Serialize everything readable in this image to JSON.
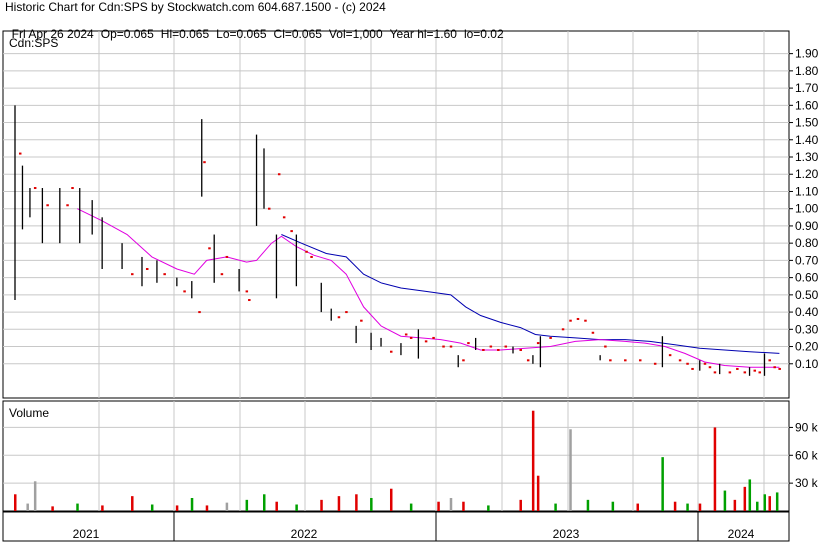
{
  "header": {
    "title": "Historic Chart for Cdn:SPS by Stockwatch.com 604.687.1500 - (c) 2024",
    "quote_parts": [
      "Fri Apr 26 2024",
      "Op=0.065",
      "Hi=0.065",
      "Lo=0.065",
      "Cl=0.065",
      "Vol=1,000",
      "Year hi=1.60",
      "lo=0.02"
    ]
  },
  "colors": {
    "price_bar": "#000000",
    "flat_day": "#e00000",
    "ma_short": "#e000e0",
    "ma_long": "#0000b0",
    "vol_up": "#00a000",
    "vol_down": "#e00000",
    "vol_flat": "#a0a0a0",
    "grid": "#c8c8c8"
  },
  "chart_data": [
    {
      "type": "ohlc",
      "label": "Cdn:SPS",
      "y_ticks": [
        "1.90",
        "1.80",
        "1.70",
        "1.60",
        "1.50",
        "1.40",
        "1.30",
        "1.20",
        "1.10",
        "1.00",
        "0.90",
        "0.80",
        "0.70",
        "0.60",
        "0.50",
        "0.40",
        "0.30",
        "0.20",
        "0.10"
      ],
      "ylim": [
        0.0,
        1.97
      ],
      "x_years": [
        "2021",
        "2022",
        "2023",
        "2024"
      ],
      "bars": [
        {
          "t": 2021.25,
          "h": 1.6,
          "l": 0.47
        },
        {
          "t": 2021.28,
          "h": 1.25,
          "l": 0.88
        },
        {
          "t": 2021.31,
          "h": 1.12,
          "l": 0.95
        },
        {
          "t": 2021.36,
          "h": 1.12,
          "l": 0.8
        },
        {
          "t": 2021.43,
          "h": 1.12,
          "l": 0.8
        },
        {
          "t": 2021.51,
          "h": 1.12,
          "l": 0.8
        },
        {
          "t": 2021.56,
          "h": 1.05,
          "l": 0.85
        },
        {
          "t": 2021.6,
          "h": 0.95,
          "l": 0.65
        },
        {
          "t": 2021.68,
          "h": 0.8,
          "l": 0.65
        },
        {
          "t": 2021.76,
          "h": 0.72,
          "l": 0.55
        },
        {
          "t": 2021.82,
          "h": 0.7,
          "l": 0.57
        },
        {
          "t": 2021.9,
          "h": 0.6,
          "l": 0.55
        },
        {
          "t": 2021.96,
          "h": 0.58,
          "l": 0.48
        },
        {
          "t": 2022.0,
          "h": 1.52,
          "l": 1.07
        },
        {
          "t": 2022.05,
          "h": 0.85,
          "l": 0.57
        },
        {
          "t": 2022.15,
          "h": 0.65,
          "l": 0.52
        },
        {
          "t": 2022.22,
          "h": 1.43,
          "l": 0.9
        },
        {
          "t": 2022.25,
          "h": 1.35,
          "l": 1.0
        },
        {
          "t": 2022.3,
          "h": 0.85,
          "l": 0.48
        },
        {
          "t": 2022.38,
          "h": 0.85,
          "l": 0.55
        },
        {
          "t": 2022.48,
          "h": 0.57,
          "l": 0.4
        },
        {
          "t": 2022.52,
          "h": 0.42,
          "l": 0.35
        },
        {
          "t": 2022.62,
          "h": 0.32,
          "l": 0.22
        },
        {
          "t": 2022.68,
          "h": 0.28,
          "l": 0.18
        },
        {
          "t": 2022.72,
          "h": 0.25,
          "l": 0.2
        },
        {
          "t": 2022.8,
          "h": 0.22,
          "l": 0.15
        },
        {
          "t": 2022.87,
          "h": 0.3,
          "l": 0.13
        },
        {
          "t": 2023.03,
          "h": 0.15,
          "l": 0.08
        },
        {
          "t": 2023.1,
          "h": 0.25,
          "l": 0.18
        },
        {
          "t": 2023.25,
          "h": 0.2,
          "l": 0.16
        },
        {
          "t": 2023.33,
          "h": 0.15,
          "l": 0.1
        },
        {
          "t": 2023.36,
          "h": 0.26,
          "l": 0.08
        },
        {
          "t": 2023.6,
          "h": 0.15,
          "l": 0.12
        },
        {
          "t": 2023.85,
          "h": 0.26,
          "l": 0.08
        },
        {
          "t": 2024.0,
          "h": 0.12,
          "l": 0.06
        },
        {
          "t": 2024.08,
          "h": 0.1,
          "l": 0.04
        },
        {
          "t": 2024.2,
          "h": 0.08,
          "l": 0.03
        },
        {
          "t": 2024.26,
          "h": 0.16,
          "l": 0.03
        }
      ],
      "flat_days": [
        {
          "t": 2021.27,
          "v": 1.32
        },
        {
          "t": 2021.33,
          "v": 1.12
        },
        {
          "t": 2021.38,
          "v": 1.02
        },
        {
          "t": 2021.46,
          "v": 1.02
        },
        {
          "t": 2021.48,
          "v": 1.12
        },
        {
          "t": 2021.72,
          "v": 0.62
        },
        {
          "t": 2021.78,
          "v": 0.65
        },
        {
          "t": 2021.85,
          "v": 0.62
        },
        {
          "t": 2021.93,
          "v": 0.52
        },
        {
          "t": 2021.99,
          "v": 0.4
        },
        {
          "t": 2022.01,
          "v": 1.27
        },
        {
          "t": 2022.03,
          "v": 0.77
        },
        {
          "t": 2022.08,
          "v": 0.62
        },
        {
          "t": 2022.1,
          "v": 0.72
        },
        {
          "t": 2022.18,
          "v": 0.52
        },
        {
          "t": 2022.19,
          "v": 0.47
        },
        {
          "t": 2022.27,
          "v": 1.0
        },
        {
          "t": 2022.31,
          "v": 1.2
        },
        {
          "t": 2022.33,
          "v": 0.95
        },
        {
          "t": 2022.36,
          "v": 0.87
        },
        {
          "t": 2022.42,
          "v": 0.75
        },
        {
          "t": 2022.44,
          "v": 0.72
        },
        {
          "t": 2022.55,
          "v": 0.37
        },
        {
          "t": 2022.58,
          "v": 0.4
        },
        {
          "t": 2022.64,
          "v": 0.35
        },
        {
          "t": 2022.76,
          "v": 0.17
        },
        {
          "t": 2022.82,
          "v": 0.27
        },
        {
          "t": 2022.84,
          "v": 0.25
        },
        {
          "t": 2022.9,
          "v": 0.23
        },
        {
          "t": 2022.93,
          "v": 0.25
        },
        {
          "t": 2022.97,
          "v": 0.2
        },
        {
          "t": 2023.0,
          "v": 0.2
        },
        {
          "t": 2023.05,
          "v": 0.12
        },
        {
          "t": 2023.07,
          "v": 0.22
        },
        {
          "t": 2023.13,
          "v": 0.18
        },
        {
          "t": 2023.16,
          "v": 0.2
        },
        {
          "t": 2023.19,
          "v": 0.18
        },
        {
          "t": 2023.22,
          "v": 0.2
        },
        {
          "t": 2023.28,
          "v": 0.18
        },
        {
          "t": 2023.31,
          "v": 0.12
        },
        {
          "t": 2023.35,
          "v": 0.22
        },
        {
          "t": 2023.4,
          "v": 0.25
        },
        {
          "t": 2023.45,
          "v": 0.3
        },
        {
          "t": 2023.48,
          "v": 0.35
        },
        {
          "t": 2023.51,
          "v": 0.36
        },
        {
          "t": 2023.54,
          "v": 0.35
        },
        {
          "t": 2023.57,
          "v": 0.28
        },
        {
          "t": 2023.62,
          "v": 0.2
        },
        {
          "t": 2023.64,
          "v": 0.12
        },
        {
          "t": 2023.7,
          "v": 0.12
        },
        {
          "t": 2023.76,
          "v": 0.12
        },
        {
          "t": 2023.82,
          "v": 0.1
        },
        {
          "t": 2023.88,
          "v": 0.15
        },
        {
          "t": 2023.92,
          "v": 0.12
        },
        {
          "t": 2023.95,
          "v": 0.1
        },
        {
          "t": 2023.97,
          "v": 0.07
        },
        {
          "t": 2024.02,
          "v": 0.1
        },
        {
          "t": 2024.04,
          "v": 0.08
        },
        {
          "t": 2024.06,
          "v": 0.05
        },
        {
          "t": 2024.12,
          "v": 0.05
        },
        {
          "t": 2024.15,
          "v": 0.07
        },
        {
          "t": 2024.18,
          "v": 0.05
        },
        {
          "t": 2024.22,
          "v": 0.06
        },
        {
          "t": 2024.24,
          "v": 0.05
        },
        {
          "t": 2024.28,
          "v": 0.12
        },
        {
          "t": 2024.3,
          "v": 0.08
        },
        {
          "t": 2024.32,
          "v": 0.07
        }
      ],
      "ma_short": [
        {
          "t": 2021.5,
          "v": 1.0
        },
        {
          "t": 2021.6,
          "v": 0.93
        },
        {
          "t": 2021.7,
          "v": 0.85
        },
        {
          "t": 2021.8,
          "v": 0.72
        },
        {
          "t": 2021.9,
          "v": 0.65
        },
        {
          "t": 2021.97,
          "v": 0.62
        },
        {
          "t": 2022.02,
          "v": 0.7
        },
        {
          "t": 2022.1,
          "v": 0.72
        },
        {
          "t": 2022.18,
          "v": 0.69
        },
        {
          "t": 2022.22,
          "v": 0.7
        },
        {
          "t": 2022.28,
          "v": 0.8
        },
        {
          "t": 2022.32,
          "v": 0.84
        },
        {
          "t": 2022.38,
          "v": 0.78
        },
        {
          "t": 2022.45,
          "v": 0.73
        },
        {
          "t": 2022.52,
          "v": 0.7
        },
        {
          "t": 2022.58,
          "v": 0.62
        },
        {
          "t": 2022.65,
          "v": 0.43
        },
        {
          "t": 2022.72,
          "v": 0.32
        },
        {
          "t": 2022.8,
          "v": 0.26
        },
        {
          "t": 2022.88,
          "v": 0.25
        },
        {
          "t": 2022.96,
          "v": 0.24
        },
        {
          "t": 2023.04,
          "v": 0.22
        },
        {
          "t": 2023.12,
          "v": 0.18
        },
        {
          "t": 2023.2,
          "v": 0.18
        },
        {
          "t": 2023.3,
          "v": 0.19
        },
        {
          "t": 2023.4,
          "v": 0.2
        },
        {
          "t": 2023.5,
          "v": 0.23
        },
        {
          "t": 2023.6,
          "v": 0.24
        },
        {
          "t": 2023.7,
          "v": 0.23
        },
        {
          "t": 2023.78,
          "v": 0.22
        },
        {
          "t": 2023.86,
          "v": 0.2
        },
        {
          "t": 2023.94,
          "v": 0.16
        },
        {
          "t": 2024.02,
          "v": 0.11
        },
        {
          "t": 2024.1,
          "v": 0.09
        },
        {
          "t": 2024.2,
          "v": 0.08
        },
        {
          "t": 2024.32,
          "v": 0.08
        }
      ],
      "ma_long": [
        {
          "t": 2022.32,
          "v": 0.85
        },
        {
          "t": 2022.4,
          "v": 0.8
        },
        {
          "t": 2022.5,
          "v": 0.74
        },
        {
          "t": 2022.58,
          "v": 0.72
        },
        {
          "t": 2022.65,
          "v": 0.62
        },
        {
          "t": 2022.72,
          "v": 0.57
        },
        {
          "t": 2022.8,
          "v": 0.54
        },
        {
          "t": 2022.9,
          "v": 0.52
        },
        {
          "t": 2023.0,
          "v": 0.5
        },
        {
          "t": 2023.06,
          "v": 0.43
        },
        {
          "t": 2023.12,
          "v": 0.38
        },
        {
          "t": 2023.2,
          "v": 0.34
        },
        {
          "t": 2023.28,
          "v": 0.31
        },
        {
          "t": 2023.34,
          "v": 0.27
        },
        {
          "t": 2023.4,
          "v": 0.26
        },
        {
          "t": 2023.5,
          "v": 0.25
        },
        {
          "t": 2023.6,
          "v": 0.24
        },
        {
          "t": 2023.7,
          "v": 0.24
        },
        {
          "t": 2023.8,
          "v": 0.23
        },
        {
          "t": 2023.9,
          "v": 0.21
        },
        {
          "t": 2024.0,
          "v": 0.19
        },
        {
          "t": 2024.1,
          "v": 0.18
        },
        {
          "t": 2024.2,
          "v": 0.17
        },
        {
          "t": 2024.32,
          "v": 0.16
        }
      ]
    },
    {
      "type": "bar",
      "label": "Volume",
      "y_ticks": [
        "90 k",
        "60 k",
        "30 k"
      ],
      "ylim": [
        0,
        112
      ],
      "volumes": [
        {
          "t": 2021.25,
          "v": 18,
          "c": "down"
        },
        {
          "t": 2021.3,
          "v": 8,
          "c": "flat"
        },
        {
          "t": 2021.33,
          "v": 32,
          "c": "flat"
        },
        {
          "t": 2021.4,
          "v": 5,
          "c": "down"
        },
        {
          "t": 2021.5,
          "v": 8,
          "c": "up"
        },
        {
          "t": 2021.6,
          "v": 6,
          "c": "down"
        },
        {
          "t": 2021.72,
          "v": 16,
          "c": "down"
        },
        {
          "t": 2021.8,
          "v": 7,
          "c": "up"
        },
        {
          "t": 2021.9,
          "v": 6,
          "c": "down"
        },
        {
          "t": 2021.96,
          "v": 14,
          "c": "up"
        },
        {
          "t": 2022.02,
          "v": 6,
          "c": "down"
        },
        {
          "t": 2022.1,
          "v": 9,
          "c": "flat"
        },
        {
          "t": 2022.18,
          "v": 12,
          "c": "up"
        },
        {
          "t": 2022.25,
          "v": 18,
          "c": "up"
        },
        {
          "t": 2022.3,
          "v": 10,
          "c": "down"
        },
        {
          "t": 2022.38,
          "v": 7,
          "c": "up"
        },
        {
          "t": 2022.48,
          "v": 12,
          "c": "down"
        },
        {
          "t": 2022.55,
          "v": 16,
          "c": "down"
        },
        {
          "t": 2022.62,
          "v": 18,
          "c": "down"
        },
        {
          "t": 2022.68,
          "v": 14,
          "c": "up"
        },
        {
          "t": 2022.76,
          "v": 24,
          "c": "down"
        },
        {
          "t": 2022.84,
          "v": 8,
          "c": "up"
        },
        {
          "t": 2022.95,
          "v": 10,
          "c": "down"
        },
        {
          "t": 2023.0,
          "v": 14,
          "c": "flat"
        },
        {
          "t": 2023.05,
          "v": 10,
          "c": "down"
        },
        {
          "t": 2023.15,
          "v": 6,
          "c": "up"
        },
        {
          "t": 2023.28,
          "v": 12,
          "c": "down"
        },
        {
          "t": 2023.33,
          "v": 108,
          "c": "down"
        },
        {
          "t": 2023.35,
          "v": 38,
          "c": "down"
        },
        {
          "t": 2023.42,
          "v": 8,
          "c": "up"
        },
        {
          "t": 2023.48,
          "v": 88,
          "c": "flat"
        },
        {
          "t": 2023.55,
          "v": 12,
          "c": "up"
        },
        {
          "t": 2023.65,
          "v": 10,
          "c": "up"
        },
        {
          "t": 2023.75,
          "v": 8,
          "c": "down"
        },
        {
          "t": 2023.85,
          "v": 58,
          "c": "up"
        },
        {
          "t": 2023.9,
          "v": 10,
          "c": "down"
        },
        {
          "t": 2023.95,
          "v": 8,
          "c": "up"
        },
        {
          "t": 2024.0,
          "v": 8,
          "c": "down"
        },
        {
          "t": 2024.06,
          "v": 90,
          "c": "down"
        },
        {
          "t": 2024.1,
          "v": 22,
          "c": "up"
        },
        {
          "t": 2024.14,
          "v": 12,
          "c": "down"
        },
        {
          "t": 2024.18,
          "v": 26,
          "c": "down"
        },
        {
          "t": 2024.2,
          "v": 34,
          "c": "up"
        },
        {
          "t": 2024.23,
          "v": 10,
          "c": "up"
        },
        {
          "t": 2024.26,
          "v": 18,
          "c": "up"
        },
        {
          "t": 2024.28,
          "v": 16,
          "c": "down"
        },
        {
          "t": 2024.31,
          "v": 20,
          "c": "up"
        }
      ]
    }
  ]
}
